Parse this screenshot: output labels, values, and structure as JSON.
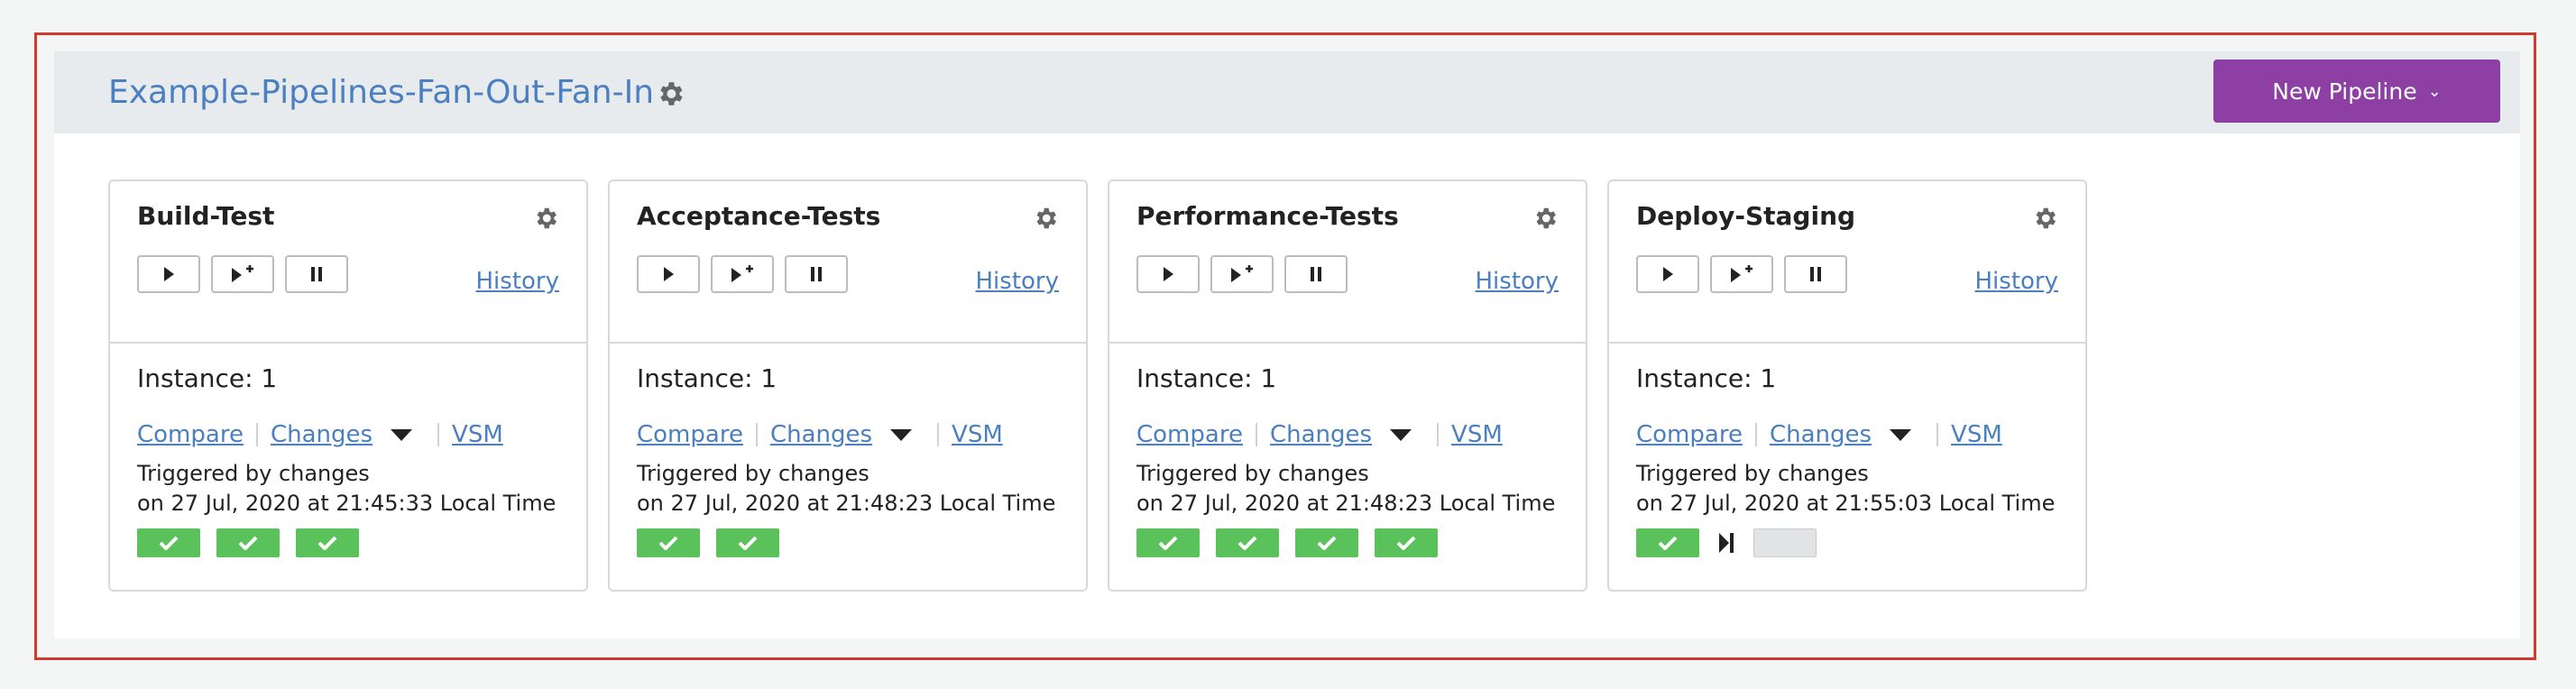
{
  "group": {
    "title": "Example-Pipelines-Fan-Out-Fan-In",
    "new_pipeline_label": "New Pipeline",
    "icons": {
      "settings": "gear-icon",
      "dropdown": "chevron-down-icon"
    }
  },
  "common": {
    "history_label": "History",
    "compare_label": "Compare",
    "changes_label": "Changes",
    "vsm_label": "VSM",
    "triggered_by": "Triggered by changes"
  },
  "pipelines": [
    {
      "name": "Build-Test",
      "instance": "Instance: 1",
      "time": "on 27 Jul, 2020 at 21:45:33 Local Time",
      "stages": [
        "passed",
        "passed",
        "passed"
      ]
    },
    {
      "name": "Acceptance-Tests",
      "instance": "Instance: 1",
      "time": "on 27 Jul, 2020 at 21:48:23 Local Time",
      "stages": [
        "passed",
        "passed"
      ]
    },
    {
      "name": "Performance-Tests",
      "instance": "Instance: 1",
      "time": "on 27 Jul, 2020 at 21:48:23 Local Time",
      "stages": [
        "passed",
        "passed",
        "passed",
        "passed"
      ]
    },
    {
      "name": "Deploy-Staging",
      "instance": "Instance: 1",
      "time": "on 27 Jul, 2020 at 21:55:03 Local Time",
      "stages": [
        "passed",
        "manual",
        "not-run"
      ]
    }
  ],
  "colors": {
    "accent": "#8d3fa3",
    "link": "#4a7fc0",
    "passed": "#5bc25b",
    "frame": "#d03a2e"
  }
}
